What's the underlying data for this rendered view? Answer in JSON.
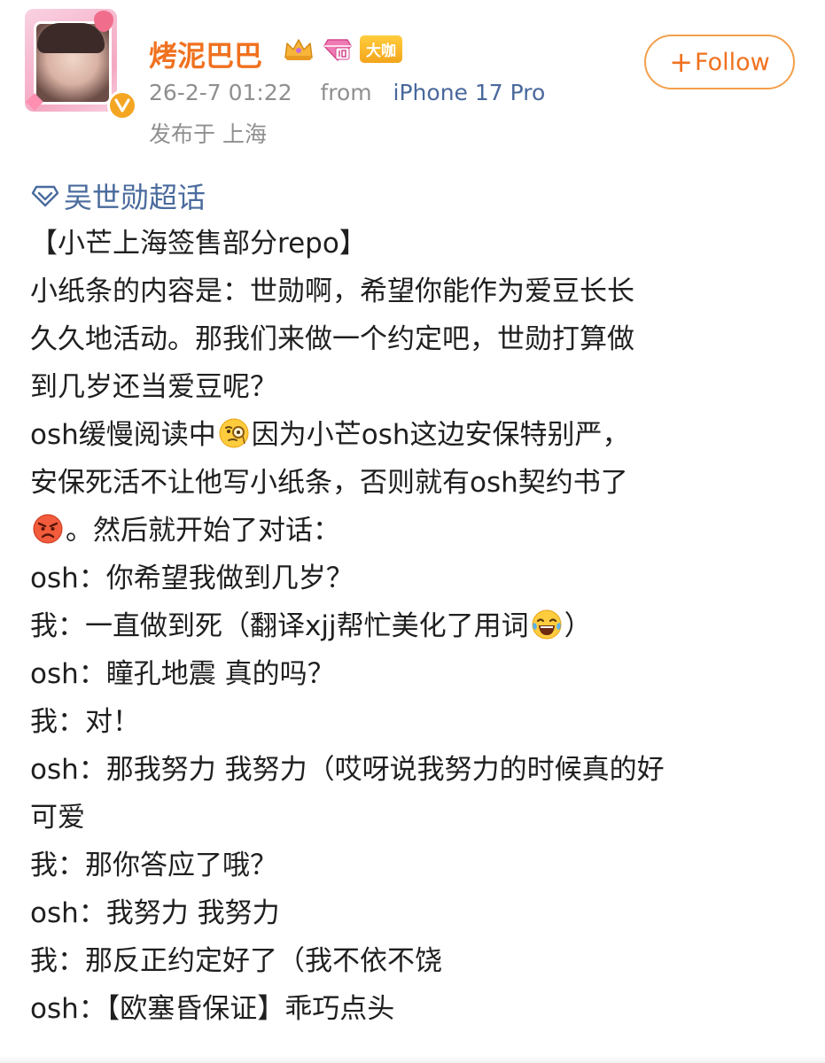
{
  "header": {
    "username": "烤泥巴巴",
    "vip_tag": "大咖",
    "timestamp": "26-2-7 01:22",
    "from_prefix": "from",
    "device": "iPhone 17 Pro",
    "location": "发布于 上海",
    "follow_label": "Follow",
    "follow_plus": "+"
  },
  "colors": {
    "username": "#f0711f",
    "link": "#4a6b9d",
    "meta": "#8f8f8f",
    "follow_border": "#f3a04c"
  },
  "post": {
    "topic": "吴世勋超话",
    "lines": [
      {
        "segments": [
          "【小芒上海签售部分repo】"
        ]
      },
      {
        "segments": [
          "小纸条的内容是：世勋啊，希望你能作为爱豆长长"
        ]
      },
      {
        "segments": [
          "久久地活动。那我们来做一个约定吧，世勋打算做"
        ]
      },
      {
        "segments": [
          "到几岁还当爱豆呢？"
        ]
      },
      {
        "segments": [
          "osh缓慢阅读中",
          "因为小芒osh这边安保特别严，"
        ]
      },
      {
        "segments": [
          "安保死活不让他写小纸条，否则就有osh契约书了"
        ]
      },
      {
        "segments": [
          "",
          "。然后就开始了对话："
        ]
      },
      {
        "segments": [
          "osh：你希望我做到几岁？"
        ]
      },
      {
        "segments": [
          "我：一直做到死（翻译xjj帮忙美化了用词",
          "）"
        ]
      },
      {
        "segments": [
          "osh：瞳孔地震 真的吗？"
        ]
      },
      {
        "segments": [
          "我：对！"
        ]
      },
      {
        "segments": [
          "osh：那我努力 我努力（哎呀说我努力的时候真的好"
        ]
      },
      {
        "segments": [
          "可爱"
        ]
      },
      {
        "segments": [
          "我：那你答应了哦？"
        ]
      },
      {
        "segments": [
          "osh：我努力 我努力"
        ]
      },
      {
        "segments": [
          "我：那反正约定好了（我不依不饶"
        ]
      },
      {
        "segments": [
          "osh：【欧塞昏保证】乖巧点头"
        ]
      }
    ],
    "emojis": [
      "thinking-monocle-emoji",
      "angry-face-emoji",
      "laughing-tears-emoji"
    ]
  }
}
